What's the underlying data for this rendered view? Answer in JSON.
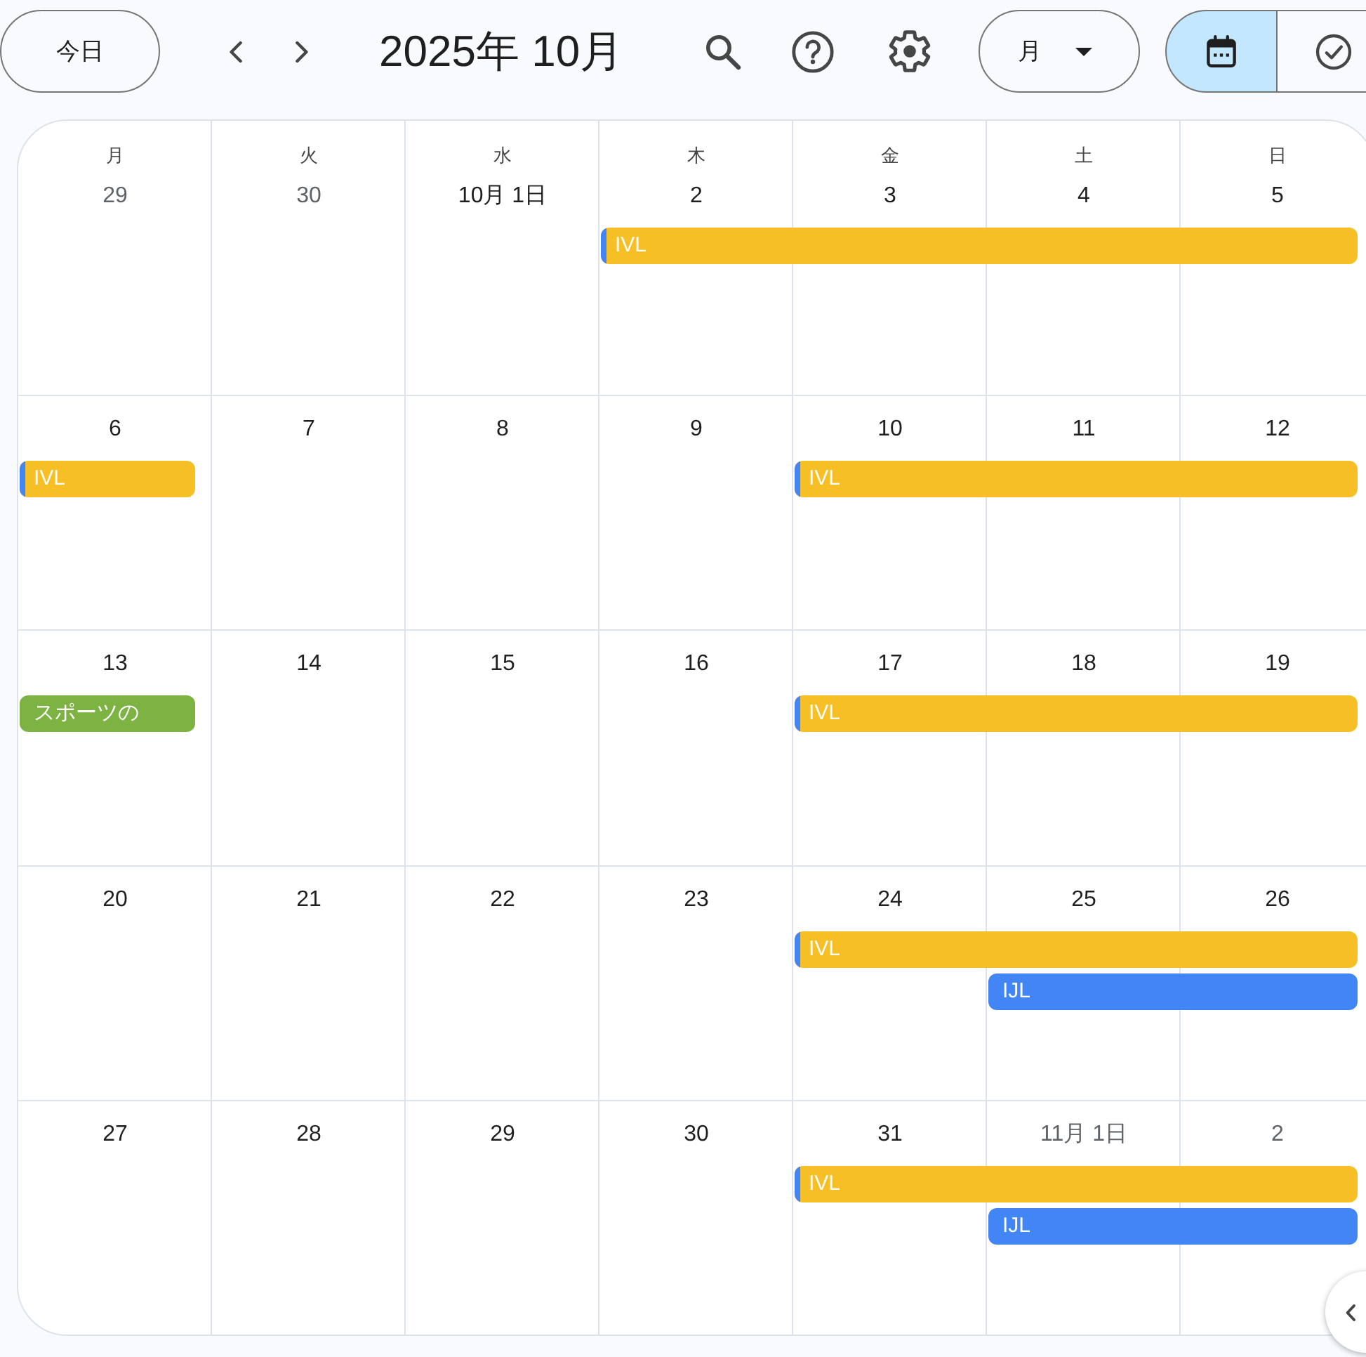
{
  "toolbar": {
    "today_button": "今日",
    "title": "2025年 10月",
    "view_menu": "月",
    "view_toggle": [
      {
        "kind": "calendar",
        "selected": true
      },
      {
        "kind": "tasks",
        "selected": false
      }
    ]
  },
  "calendar": {
    "weekdays": [
      "月",
      "火",
      "水",
      "木",
      "金",
      "土",
      "日"
    ],
    "weeks": [
      {
        "days": [
          {
            "label": "29",
            "other_month": true
          },
          {
            "label": "30",
            "other_month": true
          },
          {
            "label": "10月 1日",
            "other_month": false
          },
          {
            "label": "2",
            "other_month": false
          },
          {
            "label": "3",
            "other_month": false
          },
          {
            "label": "4",
            "other_month": false
          },
          {
            "label": "5",
            "other_month": false
          }
        ],
        "event_rows": [
          [
            {
              "kind": "empty"
            },
            {
              "kind": "empty"
            },
            {
              "kind": "empty"
            },
            {
              "kind": "event",
              "title": "IVL",
              "color": "#f6bf26",
              "stripe": {
                "color": "#4285f4"
              }
            },
            {
              "kind": "continued"
            },
            {
              "kind": "continued"
            },
            {
              "kind": "continued"
            }
          ]
        ]
      },
      {
        "days": [
          {
            "label": "6",
            "other_month": false
          },
          {
            "label": "7",
            "other_month": false
          },
          {
            "label": "8",
            "other_month": false
          },
          {
            "label": "9",
            "other_month": false
          },
          {
            "label": "10",
            "other_month": false
          },
          {
            "label": "11",
            "other_month": false
          },
          {
            "label": "12",
            "other_month": false
          }
        ],
        "event_rows": [
          [
            {
              "kind": "event",
              "title": "IVL",
              "color": "#f6bf26",
              "stripe": {
                "color": "#4285f4"
              }
            },
            {
              "kind": "empty"
            },
            {
              "kind": "empty"
            },
            {
              "kind": "empty"
            },
            {
              "kind": "event",
              "title": "IVL",
              "color": "#f6bf26",
              "stripe": {
                "color": "#4285f4"
              }
            },
            {
              "kind": "continued"
            },
            {
              "kind": "continued"
            }
          ]
        ]
      },
      {
        "days": [
          {
            "label": "13",
            "other_month": false
          },
          {
            "label": "14",
            "other_month": false
          },
          {
            "label": "15",
            "other_month": false
          },
          {
            "label": "16",
            "other_month": false
          },
          {
            "label": "17",
            "other_month": false
          },
          {
            "label": "18",
            "other_month": false
          },
          {
            "label": "19",
            "other_month": false
          }
        ],
        "event_rows": [
          [
            {
              "kind": "event",
              "title": "スポーツの",
              "color": "#7cb342"
            },
            {
              "kind": "empty"
            },
            {
              "kind": "empty"
            },
            {
              "kind": "empty"
            },
            {
              "kind": "event",
              "title": "IVL",
              "color": "#f6bf26",
              "stripe": {
                "color": "#4285f4"
              }
            },
            {
              "kind": "continued"
            },
            {
              "kind": "continued"
            }
          ]
        ]
      },
      {
        "days": [
          {
            "label": "20",
            "other_month": false
          },
          {
            "label": "21",
            "other_month": false
          },
          {
            "label": "22",
            "other_month": false
          },
          {
            "label": "23",
            "other_month": false
          },
          {
            "label": "24",
            "other_month": false
          },
          {
            "label": "25",
            "other_month": false
          },
          {
            "label": "26",
            "other_month": false
          }
        ],
        "event_rows": [
          [
            {
              "kind": "empty"
            },
            {
              "kind": "empty"
            },
            {
              "kind": "empty"
            },
            {
              "kind": "empty"
            },
            {
              "kind": "event",
              "title": "IVL",
              "color": "#f6bf26",
              "stripe": {
                "color": "#4285f4"
              }
            },
            {
              "kind": "continued"
            },
            {
              "kind": "continued"
            }
          ],
          [
            {
              "kind": "empty"
            },
            {
              "kind": "empty"
            },
            {
              "kind": "empty"
            },
            {
              "kind": "empty"
            },
            {
              "kind": "empty"
            },
            {
              "kind": "event",
              "title": "IJL",
              "color": "#4285f4"
            },
            {
              "kind": "continued"
            }
          ]
        ]
      },
      {
        "days": [
          {
            "label": "27",
            "other_month": false
          },
          {
            "label": "28",
            "other_month": false
          },
          {
            "label": "29",
            "other_month": false
          },
          {
            "label": "30",
            "other_month": false
          },
          {
            "label": "31",
            "other_month": false
          },
          {
            "label": "11月 1日",
            "other_month": true
          },
          {
            "label": "2",
            "other_month": true
          }
        ],
        "event_rows": [
          [
            {
              "kind": "empty"
            },
            {
              "kind": "empty"
            },
            {
              "kind": "empty"
            },
            {
              "kind": "empty"
            },
            {
              "kind": "event",
              "title": "IVL",
              "color": "#f6bf26",
              "stripe": {
                "color": "#4285f4"
              }
            },
            {
              "kind": "continued"
            },
            {
              "kind": "continued"
            }
          ],
          [
            {
              "kind": "empty"
            },
            {
              "kind": "empty"
            },
            {
              "kind": "empty"
            },
            {
              "kind": "empty"
            },
            {
              "kind": "empty"
            },
            {
              "kind": "event",
              "title": "IJL",
              "color": "#4285f4"
            },
            {
              "kind": "continued"
            }
          ]
        ]
      }
    ]
  }
}
